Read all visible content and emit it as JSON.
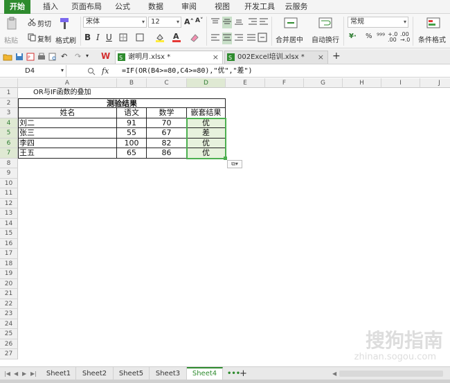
{
  "ribbon_tabs": [
    "开始",
    "插入",
    "页面布局",
    "公式",
    "数据",
    "审阅",
    "视图",
    "开发工具",
    "云服务"
  ],
  "ribbon": {
    "cut": "剪切",
    "copy": "复制",
    "format_painter": "格式刷",
    "paste": "粘贴",
    "font_name": "宋体",
    "font_size": "12",
    "merge_center": "合并居中",
    "wrap_text": "自动换行",
    "number_format": "常规",
    "conditional_format": "条件格式"
  },
  "documents": [
    {
      "name": "谢明月.xlsx *",
      "active": true
    },
    {
      "name": "002Excel培训.xlsx *",
      "active": false
    }
  ],
  "formula_bar": {
    "name_box": "D4",
    "fx": "fx",
    "formula": "=IF(OR(B4>=80,C4>=80),\"优\",\"差\")"
  },
  "columns": [
    "A",
    "B",
    "C",
    "D",
    "E",
    "F",
    "G",
    "H",
    "I",
    "J"
  ],
  "rows": [
    "1",
    "2",
    "3",
    "4",
    "5",
    "6",
    "7",
    "8",
    "9",
    "10",
    "11",
    "12",
    "13",
    "14",
    "15",
    "16",
    "17",
    "18",
    "19",
    "20",
    "21",
    "22",
    "23",
    "24",
    "25",
    "26",
    "27"
  ],
  "sheet": {
    "a1": "OR与IF函数的叠加",
    "title": "测验结果",
    "headers": [
      "姓名",
      "语文",
      "数学",
      "嵌套结果"
    ],
    "data": [
      [
        "刘二",
        "91",
        "70",
        "优"
      ],
      [
        "张三",
        "55",
        "67",
        "差"
      ],
      [
        "李四",
        "100",
        "82",
        "优"
      ],
      [
        "王五",
        "65",
        "86",
        "优"
      ]
    ]
  },
  "sheet_tabs": [
    "Sheet1",
    "Sheet2",
    "Sheet5",
    "Sheet3",
    "Sheet4"
  ],
  "active_sheet": "Sheet4",
  "watermark": "搜狗指南",
  "watermark_url": "zhinan.sogou.com",
  "colors": {
    "accent": "#2e8b2e",
    "selection": "#4caf50"
  }
}
